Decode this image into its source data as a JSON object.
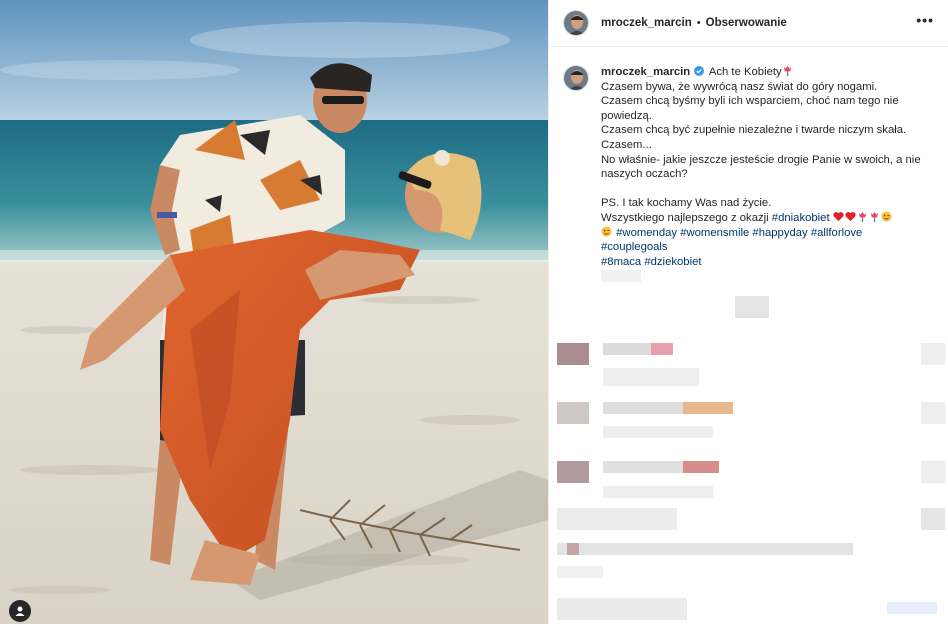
{
  "post": {
    "author": "mroczek_marcin",
    "follow_state": "Obserwowanie",
    "header_separator": "•",
    "more_label": "•••",
    "caption": {
      "username": "mroczek_marcin",
      "line1": "Ach te Kobiety",
      "line2": "Czasem bywa, że wywrócą nasz świat do góry nogami.",
      "line3": "Czasem chcą byśmy byli ich wsparciem, choć nam tego nie",
      "line4": "powiedzą.",
      "line5": "Czasem chcą być zupełnie niezależne i twarde niczym skała.",
      "line6": "Czasem...",
      "line7": "No właśnie- jakie jeszcze jesteście drogie Panie w swoich, a nie",
      "line8": "naszych oczach?",
      "line9": "PS. I tak kochamy Was nad życie.",
      "line10": "Wszystkiego najlepszego z okazji",
      "hashtags_a": [
        "#dniakobiet"
      ],
      "hashtags_b": [
        "#womenday",
        "#womensmile",
        "#happyday",
        "#allforlove",
        "#couplegoals"
      ],
      "hashtags_c": [
        "#8maca",
        "#dziekobiet"
      ]
    }
  },
  "icons": {
    "verified": "verified-badge-icon",
    "tulip": "tulip-emoji-icon",
    "heart": "red-heart-emoji-icon",
    "wink": "winking-tongue-emoji-icon",
    "user_tag": "user-tag-icon",
    "more": "more-options-icon"
  },
  "colors": {
    "hashtag": "#00376b",
    "verified": "#3897f0",
    "text": "#262626",
    "sea": "#2f7f92",
    "sand": "#e9e3d8",
    "dress": "#d7592a"
  }
}
